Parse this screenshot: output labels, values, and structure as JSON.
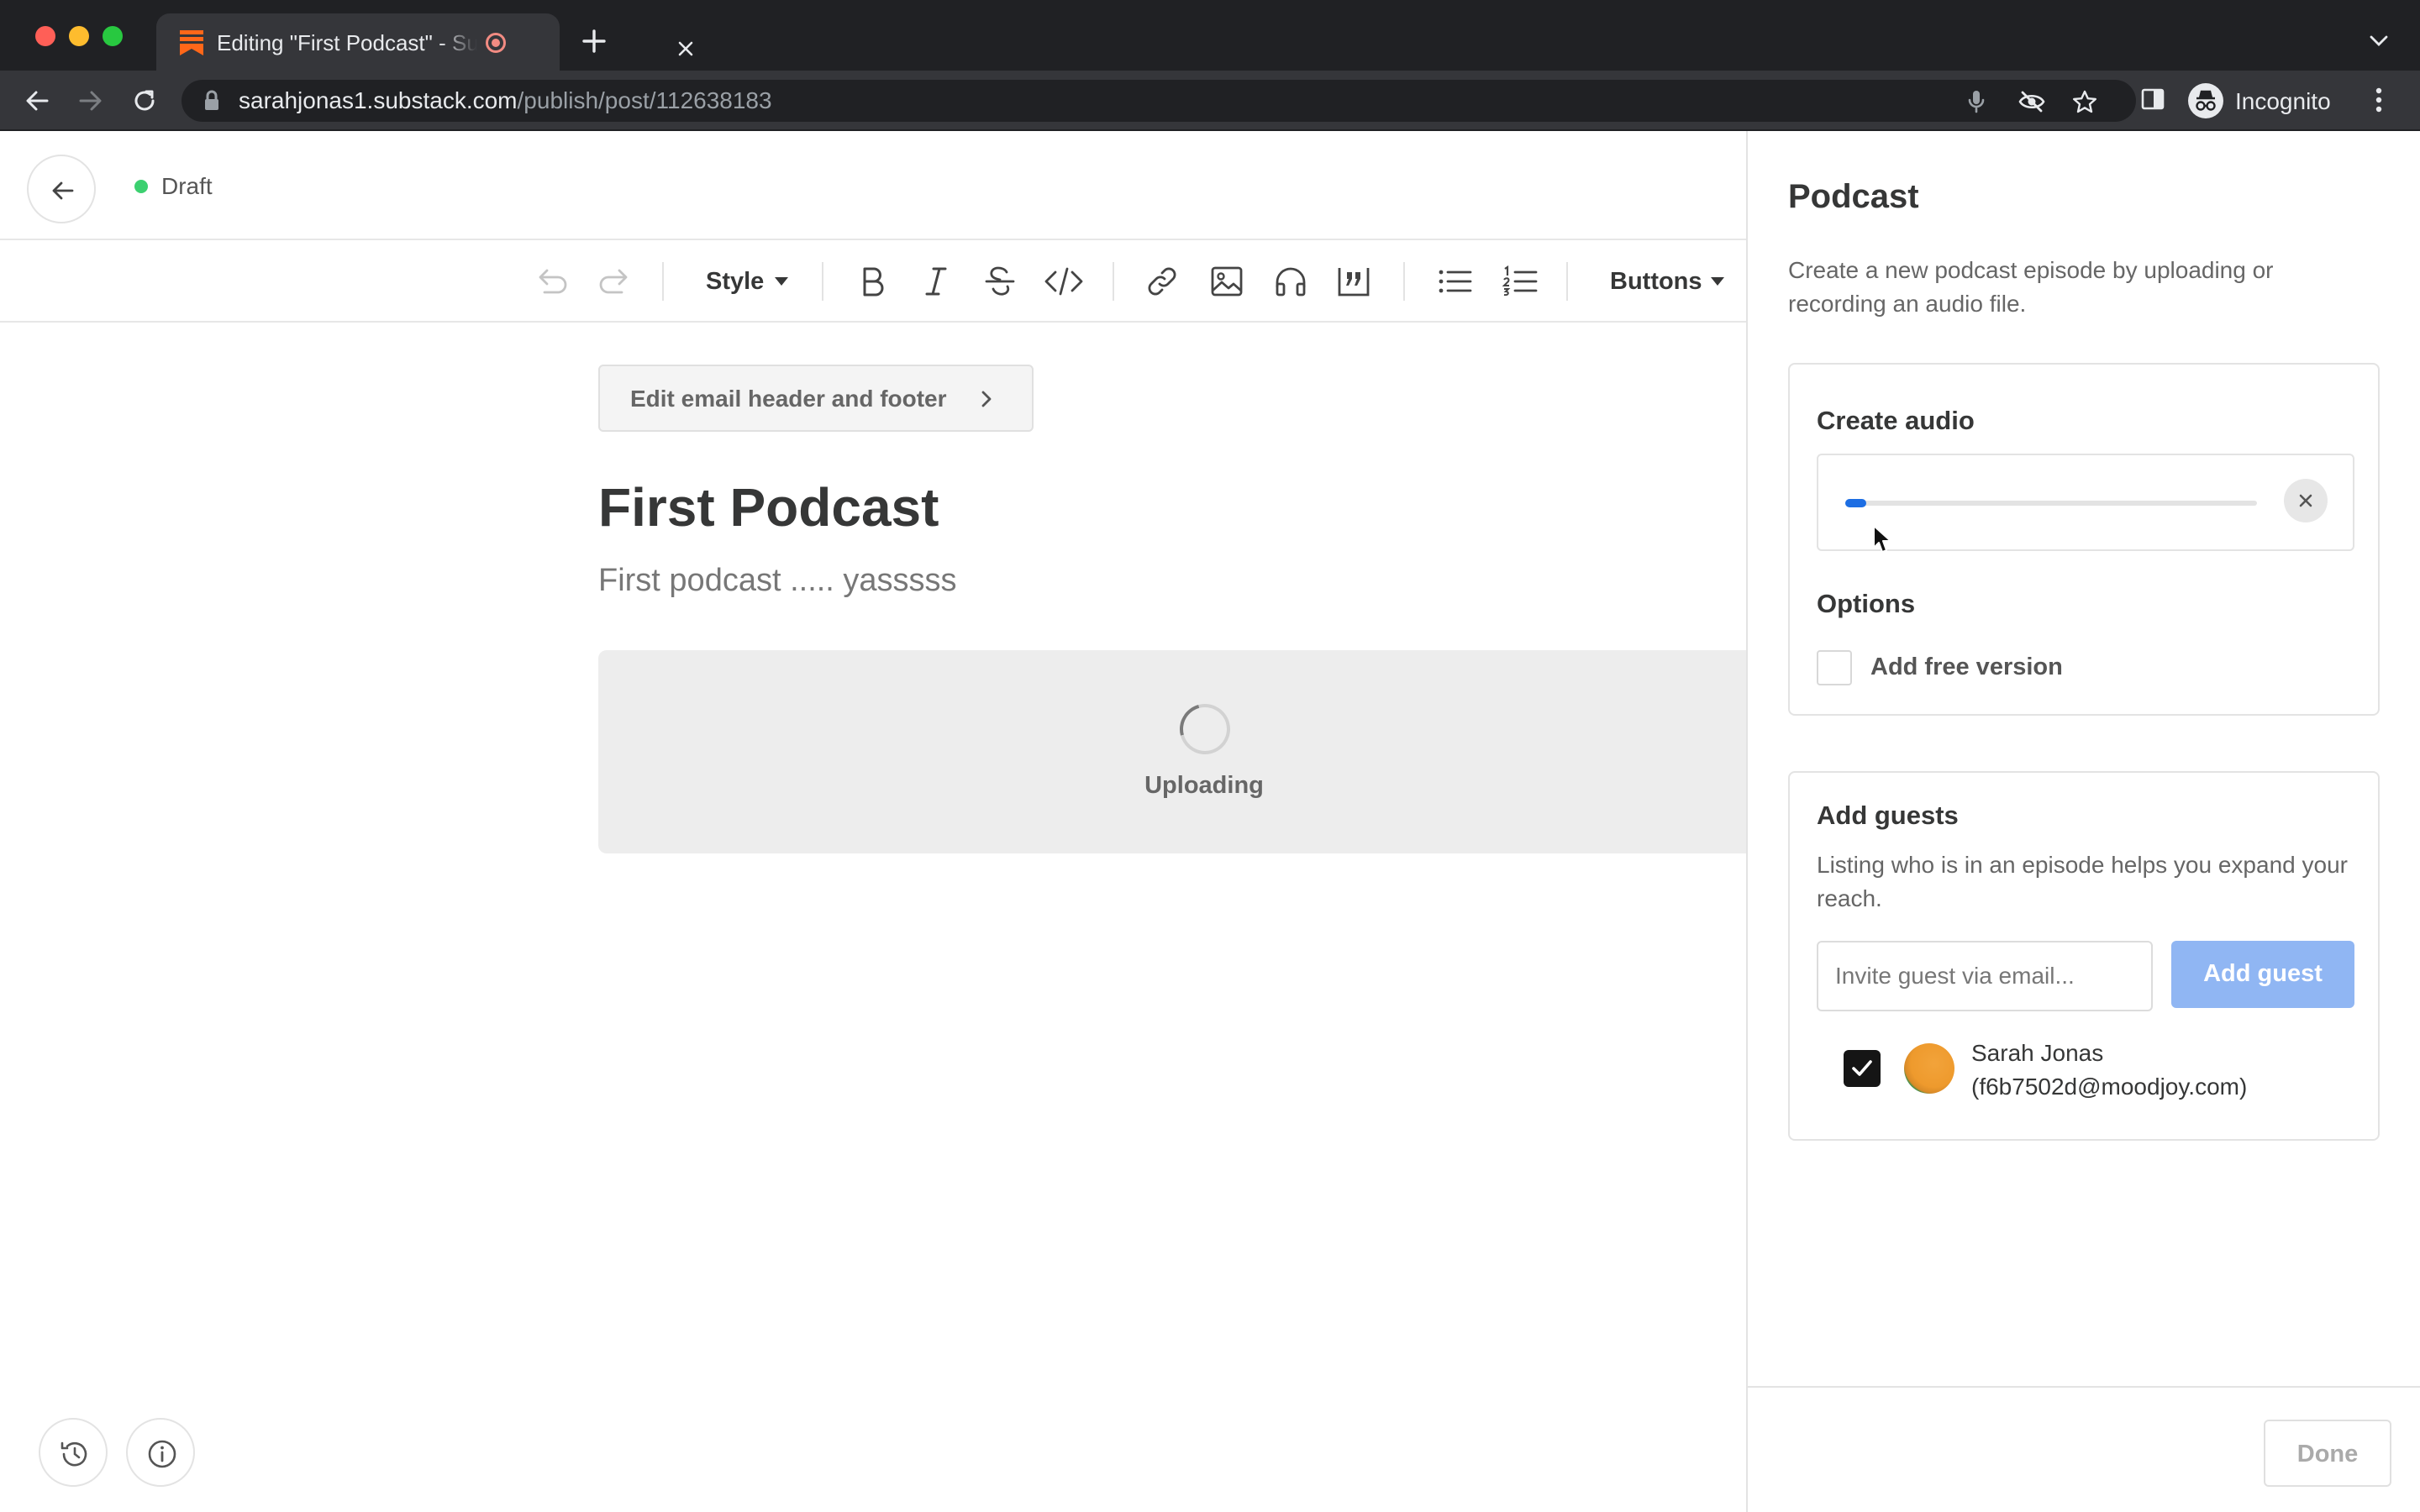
{
  "browser": {
    "tab_title": "Editing \"First Podcast\" - Substack",
    "url_host": "sarahjonas1.substack.com",
    "url_path": "/publish/post/112638183",
    "profile_label": "Incognito"
  },
  "editor": {
    "status": "Draft",
    "toolbar": {
      "style_label": "Style",
      "buttons_label": "Buttons"
    },
    "email_header_button": "Edit email header and footer",
    "post_title": "First Podcast",
    "post_subtitle": "First podcast ..... yasssss",
    "upload_status": "Uploading"
  },
  "panel": {
    "title": "Podcast",
    "description": "Create a new podcast episode by uploading or recording an audio file.",
    "create_audio": {
      "title": "Create audio",
      "upload_progress": 0.05
    },
    "options": {
      "title": "Options",
      "add_free_version_label": "Add free version",
      "add_free_version_checked": false
    },
    "guests": {
      "title": "Add guests",
      "description": "Listing who is in an episode helps you expand your reach.",
      "invite_placeholder": "Invite guest via email...",
      "add_button": "Add guest",
      "list": [
        {
          "name": "Sarah Jonas",
          "email": "(f6b7502d@moodjoy.com)",
          "checked": true
        }
      ]
    },
    "done_button": "Done"
  },
  "colors": {
    "accent": "#1d6ee3",
    "draft_dot": "#3cd070",
    "add_guest_button": "#90b6f3",
    "substack_orange": "#ff6719"
  }
}
